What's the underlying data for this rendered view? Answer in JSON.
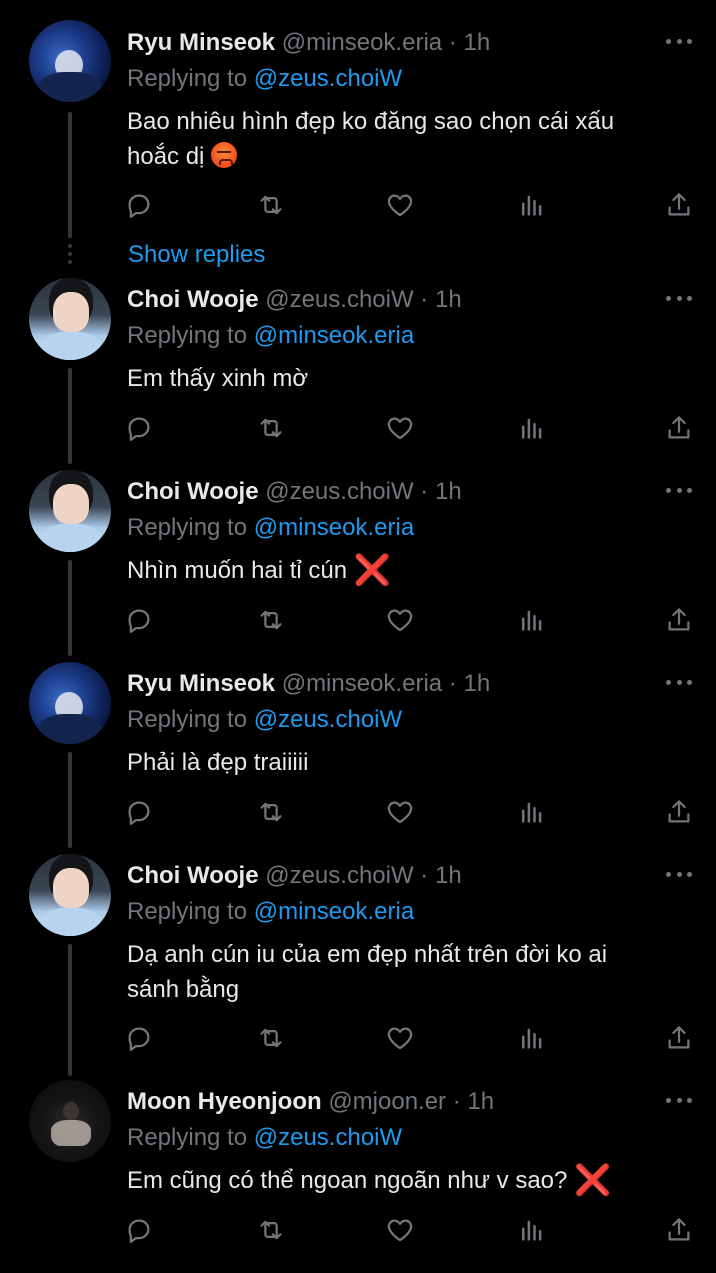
{
  "colors": {
    "background": "#000000",
    "text": "#e7e9ea",
    "muted": "#71767b",
    "accent": "#1d9bf0",
    "thread_line": "#333639"
  },
  "show_replies_label": "Show replies",
  "tweets": [
    {
      "name": "Ryu Minseok",
      "handle": "@minseok.eria",
      "sep": "·",
      "time": "1h",
      "replying_prefix": "Replying to",
      "replying_to": "@zeus.choiW",
      "text_line1": "Bao nhiêu hình đẹp ko đăng sao chọn cái xấu",
      "text_line2": "hoắc dị",
      "emoji": "angry-face"
    },
    {
      "name": "Choi Wooje",
      "handle": "@zeus.choiW",
      "sep": "·",
      "time": "1h",
      "replying_prefix": "Replying to",
      "replying_to": "@minseok.eria",
      "text_line1": "Em thấy xinh mờ"
    },
    {
      "name": "Choi Wooje",
      "handle": "@zeus.choiW",
      "sep": "·",
      "time": "1h",
      "replying_prefix": "Replying to",
      "replying_to": "@minseok.eria",
      "text_line1": "Nhìn muốn hai tỉ cún",
      "emoji": "cross-mark",
      "emoji_char": "❌"
    },
    {
      "name": "Ryu Minseok",
      "handle": "@minseok.eria",
      "sep": "·",
      "time": "1h",
      "replying_prefix": "Replying to",
      "replying_to": "@zeus.choiW",
      "text_line1": "Phải là đẹp traiiiii"
    },
    {
      "name": "Choi Wooje",
      "handle": "@zeus.choiW",
      "sep": "·",
      "time": "1h",
      "replying_prefix": "Replying to",
      "replying_to": "@minseok.eria",
      "text_line1": "Dạ anh cún iu của em đẹp nhất trên đời ko ai",
      "text_line2": "sánh bằng"
    },
    {
      "name": "Moon Hyeonjoon",
      "handle": "@mjoon.er",
      "sep": "·",
      "time": "1h",
      "replying_prefix": "Replying to",
      "replying_to": "@zeus.choiW",
      "text_line1": "Em cũng có thể ngoan ngoãn như v sao?",
      "emoji": "cross-mark",
      "emoji_char": "❌"
    }
  ],
  "icons": {
    "reply": "reply-icon",
    "retweet": "retweet-icon",
    "like": "heart-icon",
    "views": "views-icon",
    "share": "share-icon",
    "more": "more-icon"
  }
}
